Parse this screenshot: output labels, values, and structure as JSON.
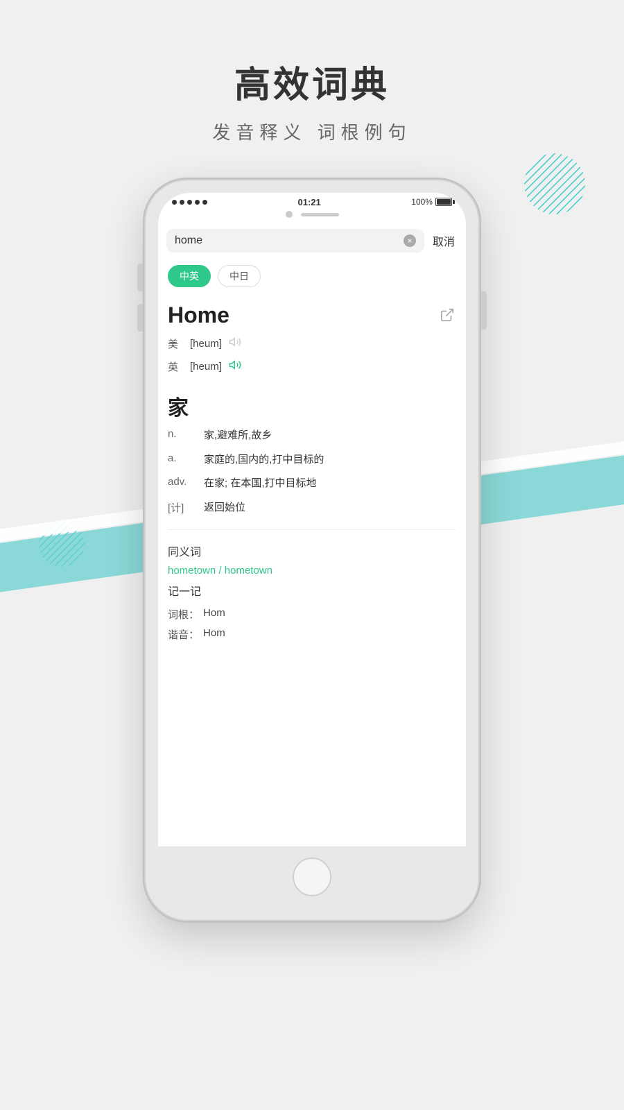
{
  "page": {
    "title": "高效词典",
    "subtitle": "发音释义  词根例句"
  },
  "phone": {
    "status": {
      "time": "01:21",
      "battery_text": "100%"
    },
    "search": {
      "query": "home",
      "clear_label": "×",
      "cancel_label": "取消"
    },
    "tabs": [
      {
        "label": "中英",
        "active": true
      },
      {
        "label": "中日",
        "active": false
      }
    ],
    "word": {
      "title": "Home",
      "pronunciation_us": "[heum]",
      "pronunciation_uk": "[heum]",
      "label_us": "美",
      "label_uk": "英",
      "chinese_char": "家",
      "definitions": [
        {
          "pos": "n.",
          "text": "家,避难所,故乡"
        },
        {
          "pos": "a.",
          "text": "家庭的,国内的,打中目标的"
        },
        {
          "pos": "adv.",
          "text": "在家; 在本国,打中目标地"
        },
        {
          "pos": "[计]",
          "text": "返回始位"
        }
      ]
    },
    "synonyms": {
      "section_title": "同义词",
      "links": "hometown / hometown"
    },
    "memory": {
      "section_title": "记一记",
      "root_label": "词根：",
      "root_value": "Hom",
      "rhyme_label": "谐音：",
      "rhyme_value": "Hom"
    }
  }
}
